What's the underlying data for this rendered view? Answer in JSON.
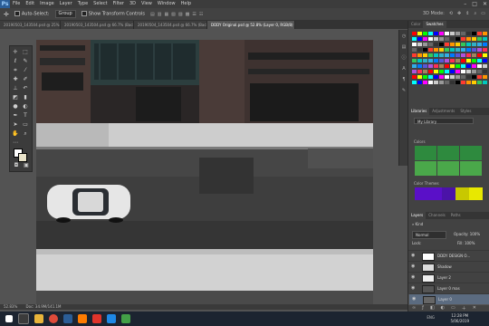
{
  "menubar": {
    "logo": "Ps",
    "items": [
      "File",
      "Edit",
      "Image",
      "Layer",
      "Type",
      "Select",
      "Filter",
      "3D",
      "View",
      "Window",
      "Help"
    ],
    "window_controls": [
      "–",
      "□",
      "✕"
    ]
  },
  "options": {
    "tool_icon": "move-tool-icon",
    "auto_select_label": "Auto-Select:",
    "auto_select_value": "Group",
    "show_transform_label": "Show Transform Controls",
    "mode_label": "3D Mode:"
  },
  "tabs": [
    {
      "label": "20190503_143504.psd @ 25% (Background copy, Layer Mask/8) *",
      "active": false
    },
    {
      "label": "20190503_143504.psd @ 66.7% (Background copy, Layer Mask/8) *",
      "active": false
    },
    {
      "label": "20190504_143504.psd @ 66.7% (Background copy, Layer Mask/8) *",
      "active": false
    },
    {
      "label": "DDDY Original.psd @ 52.8% (Layer 0, RGB/8) *",
      "active": true
    }
  ],
  "status": {
    "zoom": "52.83%",
    "doc": "Doc: 34.9M/141.1M"
  },
  "panels": {
    "color_tab": "Color",
    "swatches_tab": "Swatches",
    "swatches": [
      "#ff0000",
      "#ffff00",
      "#00ff00",
      "#00ffff",
      "#0000ff",
      "#ff00ff",
      "#ffffff",
      "#cccccc",
      "#999999",
      "#666666",
      "#333333",
      "#000000",
      "#ff3b30",
      "#ff9500",
      "#ffcc00",
      "#34c759",
      "#00c7be",
      "#30b0c7",
      "#32ade6",
      "#007aff",
      "#5856d6",
      "#af52de",
      "#ff2d55",
      "#a2845e"
    ],
    "libraries_tab": "Libraries",
    "adjustments_tab": "Adjustments",
    "styles_tab": "Styles",
    "library_name": "My Library",
    "colors_label": "Colors",
    "colors": [
      "#2e8a3e",
      "#2e8a3e",
      "#2e8a3e",
      "#4aa84a",
      "#4aa84a",
      "#4aa84a"
    ],
    "color_themes_label": "Color Themes",
    "themes": [
      "#5a10c8",
      "#5a10c8",
      "#4b13a8",
      "#c8c800",
      "#e8e800"
    ],
    "layers_tab": "Layers",
    "channels_tab": "Channels",
    "paths_tab": "Paths",
    "kind_label": "Kind",
    "blend_mode": "Normal",
    "opacity": "Opacity: 100%",
    "lock_label": "Lock:",
    "fill": "Fill: 100%",
    "layers": [
      {
        "name": "DDDY DESIGN O...",
        "selected": false
      },
      {
        "name": "Shadow",
        "selected": false
      },
      {
        "name": "Layer 2",
        "selected": false
      },
      {
        "name": "Layer 0 mas",
        "selected": false
      },
      {
        "name": "Layer 0",
        "selected": true
      }
    ]
  },
  "taskbar": {
    "time": "12:28 PM",
    "date": "5/06/2019",
    "lang": "ENG"
  }
}
